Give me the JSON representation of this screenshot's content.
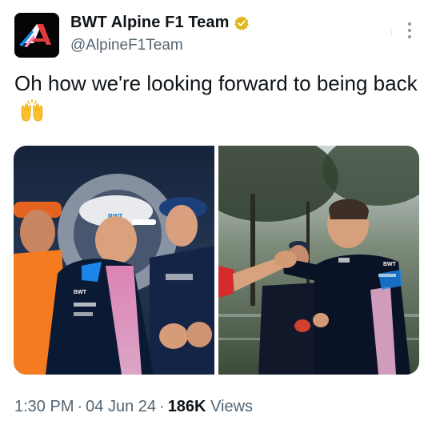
{
  "author": {
    "display_name": "BWT Alpine F1 Team",
    "handle": "@AlpineF1Team",
    "verified_badge": "verified-organization-badge",
    "badge_color": "#e2b719"
  },
  "tweet": {
    "text": "Oh how we're looking forward to being back",
    "emoji": "raising-hands"
  },
  "media": {
    "images": [
      {
        "id": "photo-drivers-handshake",
        "sponsor_text_cap": "BWT"
      },
      {
        "id": "photo-team-principal-handshake",
        "sponsor_text_shirt": "BWT"
      }
    ]
  },
  "meta": {
    "time": "1:30 PM",
    "separator": "·",
    "date": "04 Jun 24",
    "views_count": "186K",
    "views_label": "Views"
  },
  "colors": {
    "accent_pink": "#f18fc4",
    "alpine_blue": "#0d76cf",
    "muted_text": "#536471"
  }
}
